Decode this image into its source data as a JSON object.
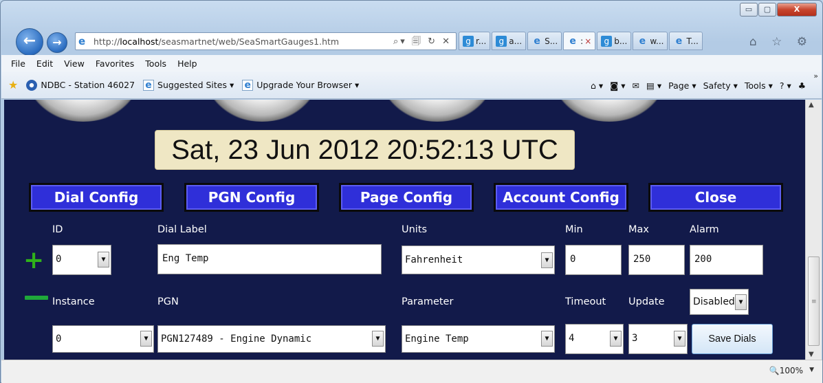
{
  "window": {
    "min_glyph": "▭",
    "max_glyph": "▢",
    "close_glyph": "X"
  },
  "nav": {
    "back_glyph": "←",
    "forward_glyph": "→"
  },
  "address": {
    "prefix": "http://",
    "host": "localhost",
    "path": "/seasmartnet/web/SeaSmartGauges1.htm",
    "tools": "⌕▾ 🗐 ↻ ✕"
  },
  "tabs": [
    {
      "icon": "google-icon",
      "label": "r..."
    },
    {
      "icon": "google-icon",
      "label": "a..."
    },
    {
      "icon": "ie-page-icon",
      "label": "S..."
    },
    {
      "icon": "ie-page-icon",
      "label": ":",
      "active": true,
      "close": "×"
    },
    {
      "icon": "google-icon",
      "label": "b..."
    },
    {
      "icon": "ie-page-icon",
      "label": "w..."
    },
    {
      "icon": "ie-page-icon",
      "label": "T..."
    }
  ],
  "top_icons": "⌂ ☆ ⚙",
  "menu": [
    "File",
    "Edit",
    "View",
    "Favorites",
    "Tools",
    "Help"
  ],
  "favorites": [
    {
      "icon": "noaa-icon",
      "label": "NDBC - Station 46027"
    },
    {
      "icon": "ie-page-icon",
      "label": "Suggested Sites ▾"
    },
    {
      "icon": "ie-page-icon",
      "label": "Upgrade Your Browser ▾"
    }
  ],
  "command_bar": {
    "home": "⌂ ▾",
    "feeds": "◙ ▾",
    "mail": "✉",
    "print": "▤ ▾",
    "page": "Page ▾",
    "safety": "Safety ▾",
    "tools": "Tools ▾",
    "help": "? ▾",
    "research": "♣",
    "more": "»"
  },
  "clock": "Sat, 23 Jun 2012 20:52:13 UTC",
  "config_buttons": [
    "Dial Config",
    "PGN Config",
    "Page Config",
    "Account Config",
    "Close"
  ],
  "row1": {
    "labels": {
      "id": "ID",
      "dial_label": "Dial Label",
      "units": "Units",
      "min": "Min",
      "max": "Max",
      "alarm": "Alarm"
    },
    "id_value": "0",
    "dial_label_value": "Eng Temp",
    "units_value": "Fahrenheit",
    "min_value": "0",
    "max_value": "250",
    "alarm_value": "200",
    "add_glyph": "+"
  },
  "row2": {
    "labels": {
      "instance": "Instance",
      "pgn": "PGN",
      "parameter": "Parameter",
      "timeout": "Timeout",
      "update": "Update"
    },
    "status_value": "Disabled",
    "instance_value": "0",
    "pgn_value": "PGN127489 - Engine Dynamic",
    "parameter_value": "Engine Temp",
    "timeout_value": "4",
    "update_value": "3",
    "save_label": "Save Dials"
  },
  "select_arrow": "▼",
  "scroll": {
    "up": "▲",
    "down": "▼",
    "grip": "≡"
  },
  "status": {
    "zoom": "🔍100%",
    "zoom_arrow": "▼"
  }
}
